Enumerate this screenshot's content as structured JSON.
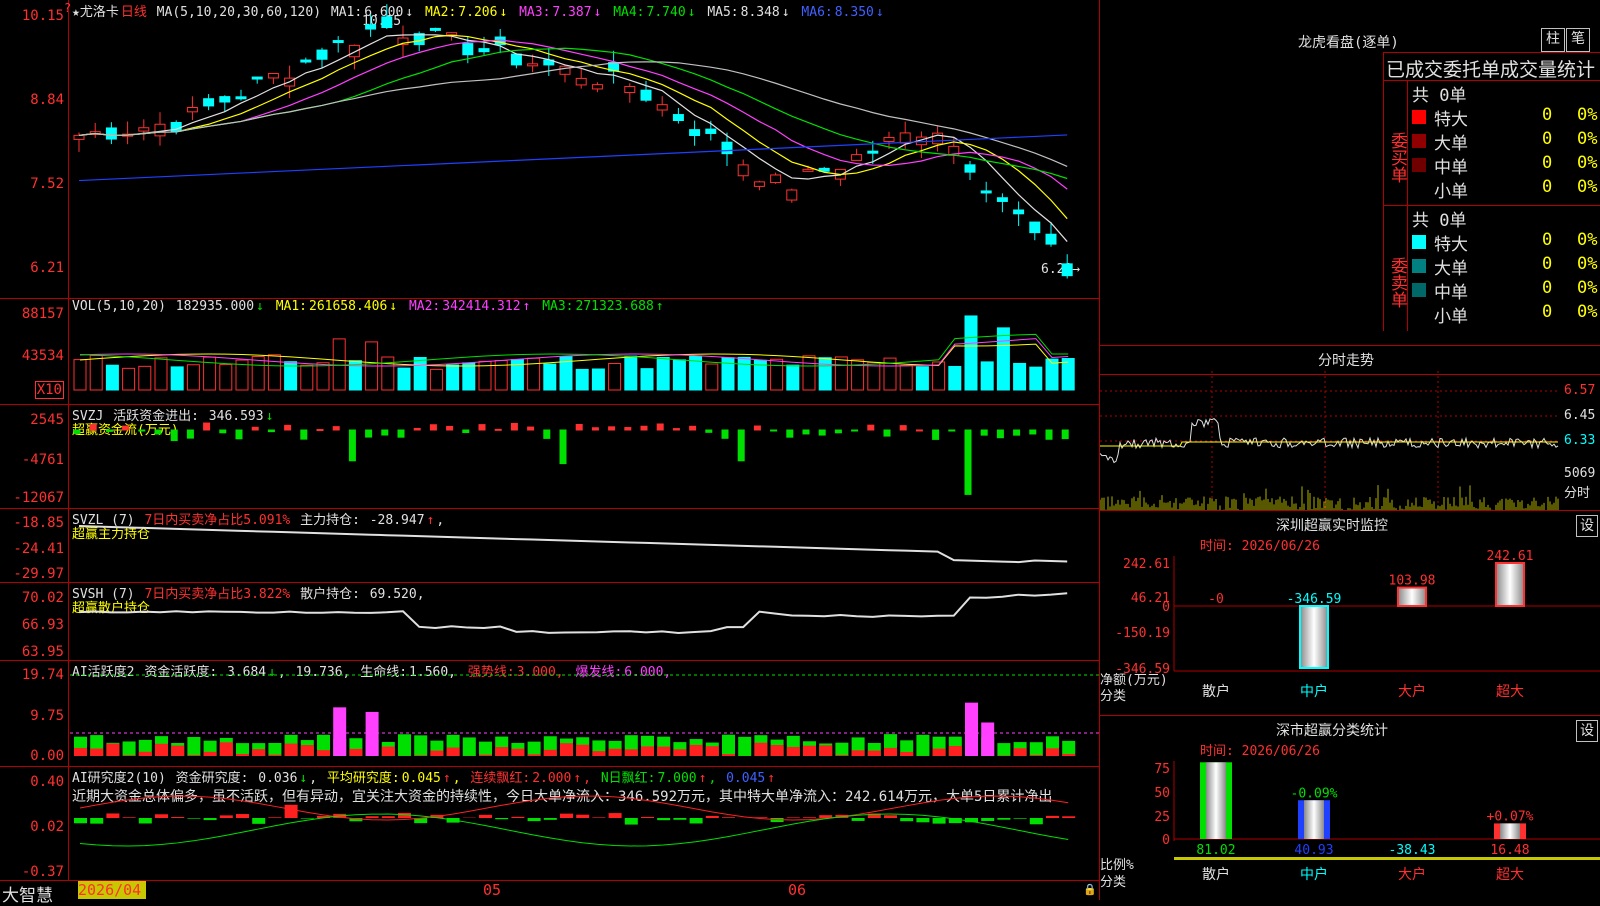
{
  "colors": {
    "up": "#ff3030",
    "down": "#00ffff",
    "grid": "#b00000",
    "ma1": "#e0e0e0",
    "ma2": "#ffff00",
    "ma3": "#ff40ff",
    "ma4": "#00e000",
    "ma5": "#c0c0c0",
    "ma6": "#2040ff"
  },
  "main": {
    "title": "★尤洛卡",
    "period": "日线",
    "ma_params": "MA(5,10,20,30,60,120)",
    "ma": [
      {
        "label": "MA1:",
        "value": "6.600",
        "arrow": "↓"
      },
      {
        "label": "MA2:",
        "value": "7.206",
        "arrow": "↓"
      },
      {
        "label": "MA3:",
        "value": "7.387",
        "arrow": "↓"
      },
      {
        "label": "MA4:",
        "value": "7.740",
        "arrow": "↓"
      },
      {
        "label": "MA5:",
        "value": "8.348",
        "arrow": "↓"
      },
      {
        "label": "MA6:",
        "value": "8.350",
        "arrow": "↓"
      }
    ],
    "y_labels": [
      "10.15",
      "8.84",
      "7.52",
      "6.21"
    ],
    "high_note": "10.15",
    "low_note": "6.21→"
  },
  "vol": {
    "title": "VOL(5,10,20)",
    "value": "182935.000",
    "arrow": "↓",
    "ma": [
      {
        "label": "MA1:",
        "value": "261658.406",
        "arrow": "↓"
      },
      {
        "label": "MA2:",
        "value": "342414.312",
        "arrow": "↑"
      },
      {
        "label": "MA3:",
        "value": "271323.688",
        "arrow": "↑"
      }
    ],
    "y_labels": [
      "88157",
      "43534"
    ],
    "unit": "X10"
  },
  "svzj": {
    "title": "SVZJ",
    "label": "活跃资金进出:",
    "value": "346.593",
    "arrow": "↓",
    "sub": "超赢资金流(万元)",
    "y_labels": [
      "2545",
      "-4761",
      "-12067"
    ]
  },
  "svzl": {
    "title": "SVZL (7)",
    "ratio": "7日内买卖净占比5.091%",
    "label": "主力持仓:",
    "value": "-28.947",
    "arrow": "↑",
    "sub": "超赢主力持仓",
    "y_labels": [
      "-18.85",
      "-24.41",
      "-29.97"
    ]
  },
  "svsh": {
    "title": "SVSH (7)",
    "ratio": "7日内买卖净占比3.822%",
    "label": "散户持仓:",
    "value": "69.520,",
    "sub": "超赢散户持仓",
    "y_labels": [
      "70.02",
      "66.93",
      "63.95"
    ]
  },
  "ai1": {
    "title": "AI活跃度2",
    "label": "资金活跃度:",
    "value": "3.684",
    "arrow": "↓",
    "v2": "19.736,",
    "life": "生命线:",
    "life_v": "1.560,",
    "strong": "强势线:",
    "strong_v": "3.000,",
    "burst": "爆发线:",
    "burst_v": "6.000,",
    "y_labels": [
      "19.74",
      "9.75",
      "0.00"
    ]
  },
  "ai2": {
    "title": "AI研究度2(10)",
    "label": "资金研究度:",
    "value": "0.036",
    "arrow": "↓",
    "avg": "平均研究度:",
    "avg_v": "0.045",
    "avg_a": "↑",
    "lian": "连续飘红:",
    "lian_v": "2.000",
    "lian_a": "↑",
    "n": "N日飘红:",
    "n_v": "7.000",
    "n_a": "↑",
    "last": "0.045",
    "last_a": "↑",
    "comment": "近期大资金总体偏多，虽不活跃，但有异动，宜关注大资金的持续性，今日大单净流入：346.592万元，其中特大单净流入：242.614万元，大单5日累计净出",
    "y_labels": [
      "0.40",
      "0.02",
      "-0.37"
    ]
  },
  "xaxis": {
    "labels": [
      "2026/04",
      "05",
      "06"
    ]
  },
  "brand": "大智慧",
  "right": {
    "lhkp_title": "龙虎看盘(逐单)",
    "tab1": "柱",
    "tab2": "笔",
    "stat_header": "已成交委托单成交量统计",
    "buy_group": "委买单",
    "sell_group": "委卖单",
    "buy_total": "共 0单",
    "sell_total": "共 0单",
    "buy_rows": [
      {
        "name": "特大",
        "v": "0",
        "p": "0%"
      },
      {
        "name": "大单",
        "v": "0",
        "p": "0%"
      },
      {
        "name": "中单",
        "v": "0",
        "p": "0%"
      },
      {
        "name": "小单",
        "v": "0",
        "p": "0%"
      }
    ],
    "sell_rows": [
      {
        "name": "特大",
        "v": "0",
        "p": "0%"
      },
      {
        "name": "大单",
        "v": "0",
        "p": "0%"
      },
      {
        "name": "中单",
        "v": "0",
        "p": "0%"
      },
      {
        "name": "小单",
        "v": "0",
        "p": "0%"
      }
    ],
    "fs_title": "分时走势",
    "fs_y": [
      "6.57",
      "6.45",
      "6.33"
    ],
    "fs_vol": "5069",
    "fs_vol_unit": "分时",
    "sz_title": "深圳超赢实时监控",
    "set": "设",
    "sz_time": "时间: 2026/06/26",
    "sz_y": [
      "242.61",
      "46.21",
      "0",
      "-150.19",
      "-346.59"
    ],
    "sz_bars": [
      {
        "cat": "散户",
        "value": -0.0,
        "label": "-0"
      },
      {
        "cat": "中户",
        "value": -346.59,
        "label": "-346.59"
      },
      {
        "cat": "大户",
        "value": 103.98,
        "label": "103.98"
      },
      {
        "cat": "超大",
        "value": 242.61,
        "label": "242.61"
      }
    ],
    "sz_ylabel1": "净额(万元)",
    "sz_ylabel2": "分类",
    "ss_title": "深市超赢分类统计",
    "ss_time": "时间: 2026/06/26",
    "ss_y": [
      "75",
      "50",
      "25",
      "0"
    ],
    "ss_bars": [
      {
        "cat": "散户",
        "value": 81.02,
        "top": "",
        "bottom": "81.02"
      },
      {
        "cat": "中户",
        "value": 40.93,
        "top": "-0.09%",
        "bottom": "40.93"
      },
      {
        "cat": "大户",
        "value": -38.43,
        "top": "",
        "bottom": "-38.43"
      },
      {
        "cat": "超大",
        "value": 16.48,
        "top": "+0.07%",
        "bottom": "16.48"
      }
    ],
    "ss_ylabel1": "比例%",
    "ss_ylabel2": "分类"
  }
}
